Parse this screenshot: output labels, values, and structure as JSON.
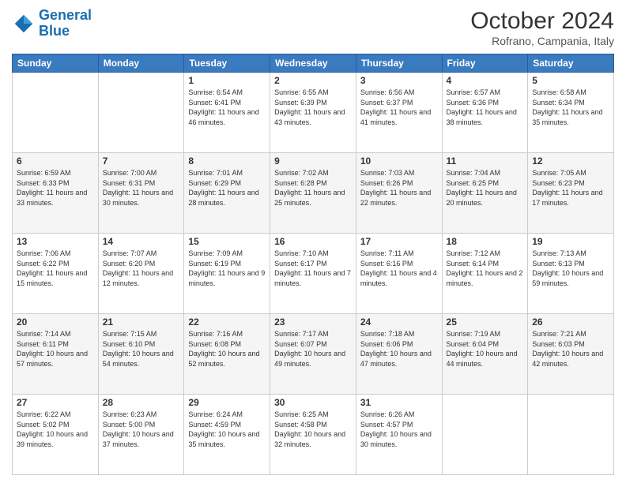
{
  "header": {
    "logo": {
      "line1": "General",
      "line2": "Blue"
    },
    "title": "October 2024",
    "location": "Rofrano, Campania, Italy"
  },
  "weekdays": [
    "Sunday",
    "Monday",
    "Tuesday",
    "Wednesday",
    "Thursday",
    "Friday",
    "Saturday"
  ],
  "weeks": [
    [
      {
        "day": null
      },
      {
        "day": null
      },
      {
        "day": 1,
        "sunrise": "6:54 AM",
        "sunset": "6:41 PM",
        "daylight": "11 hours and 46 minutes."
      },
      {
        "day": 2,
        "sunrise": "6:55 AM",
        "sunset": "6:39 PM",
        "daylight": "11 hours and 43 minutes."
      },
      {
        "day": 3,
        "sunrise": "6:56 AM",
        "sunset": "6:37 PM",
        "daylight": "11 hours and 41 minutes."
      },
      {
        "day": 4,
        "sunrise": "6:57 AM",
        "sunset": "6:36 PM",
        "daylight": "11 hours and 38 minutes."
      },
      {
        "day": 5,
        "sunrise": "6:58 AM",
        "sunset": "6:34 PM",
        "daylight": "11 hours and 35 minutes."
      }
    ],
    [
      {
        "day": 6,
        "sunrise": "6:59 AM",
        "sunset": "6:33 PM",
        "daylight": "11 hours and 33 minutes."
      },
      {
        "day": 7,
        "sunrise": "7:00 AM",
        "sunset": "6:31 PM",
        "daylight": "11 hours and 30 minutes."
      },
      {
        "day": 8,
        "sunrise": "7:01 AM",
        "sunset": "6:29 PM",
        "daylight": "11 hours and 28 minutes."
      },
      {
        "day": 9,
        "sunrise": "7:02 AM",
        "sunset": "6:28 PM",
        "daylight": "11 hours and 25 minutes."
      },
      {
        "day": 10,
        "sunrise": "7:03 AM",
        "sunset": "6:26 PM",
        "daylight": "11 hours and 22 minutes."
      },
      {
        "day": 11,
        "sunrise": "7:04 AM",
        "sunset": "6:25 PM",
        "daylight": "11 hours and 20 minutes."
      },
      {
        "day": 12,
        "sunrise": "7:05 AM",
        "sunset": "6:23 PM",
        "daylight": "11 hours and 17 minutes."
      }
    ],
    [
      {
        "day": 13,
        "sunrise": "7:06 AM",
        "sunset": "6:22 PM",
        "daylight": "11 hours and 15 minutes."
      },
      {
        "day": 14,
        "sunrise": "7:07 AM",
        "sunset": "6:20 PM",
        "daylight": "11 hours and 12 minutes."
      },
      {
        "day": 15,
        "sunrise": "7:09 AM",
        "sunset": "6:19 PM",
        "daylight": "11 hours and 9 minutes."
      },
      {
        "day": 16,
        "sunrise": "7:10 AM",
        "sunset": "6:17 PM",
        "daylight": "11 hours and 7 minutes."
      },
      {
        "day": 17,
        "sunrise": "7:11 AM",
        "sunset": "6:16 PM",
        "daylight": "11 hours and 4 minutes."
      },
      {
        "day": 18,
        "sunrise": "7:12 AM",
        "sunset": "6:14 PM",
        "daylight": "11 hours and 2 minutes."
      },
      {
        "day": 19,
        "sunrise": "7:13 AM",
        "sunset": "6:13 PM",
        "daylight": "10 hours and 59 minutes."
      }
    ],
    [
      {
        "day": 20,
        "sunrise": "7:14 AM",
        "sunset": "6:11 PM",
        "daylight": "10 hours and 57 minutes."
      },
      {
        "day": 21,
        "sunrise": "7:15 AM",
        "sunset": "6:10 PM",
        "daylight": "10 hours and 54 minutes."
      },
      {
        "day": 22,
        "sunrise": "7:16 AM",
        "sunset": "6:08 PM",
        "daylight": "10 hours and 52 minutes."
      },
      {
        "day": 23,
        "sunrise": "7:17 AM",
        "sunset": "6:07 PM",
        "daylight": "10 hours and 49 minutes."
      },
      {
        "day": 24,
        "sunrise": "7:18 AM",
        "sunset": "6:06 PM",
        "daylight": "10 hours and 47 minutes."
      },
      {
        "day": 25,
        "sunrise": "7:19 AM",
        "sunset": "6:04 PM",
        "daylight": "10 hours and 44 minutes."
      },
      {
        "day": 26,
        "sunrise": "7:21 AM",
        "sunset": "6:03 PM",
        "daylight": "10 hours and 42 minutes."
      }
    ],
    [
      {
        "day": 27,
        "sunrise": "6:22 AM",
        "sunset": "5:02 PM",
        "daylight": "10 hours and 39 minutes."
      },
      {
        "day": 28,
        "sunrise": "6:23 AM",
        "sunset": "5:00 PM",
        "daylight": "10 hours and 37 minutes."
      },
      {
        "day": 29,
        "sunrise": "6:24 AM",
        "sunset": "4:59 PM",
        "daylight": "10 hours and 35 minutes."
      },
      {
        "day": 30,
        "sunrise": "6:25 AM",
        "sunset": "4:58 PM",
        "daylight": "10 hours and 32 minutes."
      },
      {
        "day": 31,
        "sunrise": "6:26 AM",
        "sunset": "4:57 PM",
        "daylight": "10 hours and 30 minutes."
      },
      {
        "day": null
      },
      {
        "day": null
      }
    ]
  ]
}
